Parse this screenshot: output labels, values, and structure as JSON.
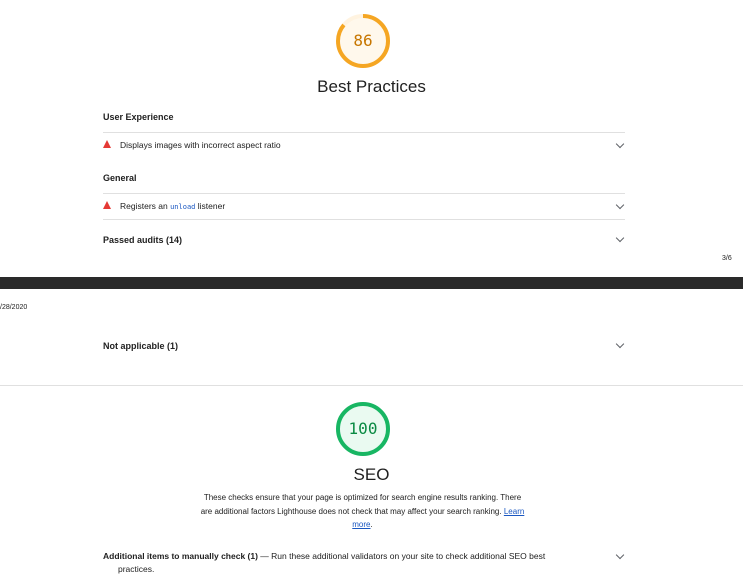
{
  "best_practices": {
    "score": "86",
    "score_fraction": 0.86,
    "score_color": "#f5a623",
    "title": "Best Practices",
    "groups": [
      {
        "title": "User Experience",
        "audit": "Displays images with incorrect aspect ratio"
      },
      {
        "title": "General",
        "audit_prefix": "Registers an",
        "audit_code": "unload",
        "audit_suffix": "listener"
      }
    ],
    "passed_audits": "Passed audits (14)"
  },
  "page_footer": {
    "page_number": "3/6"
  },
  "page_header": {
    "date": "/28/2020"
  },
  "not_applicable": "Not applicable (1)",
  "seo": {
    "score": "100",
    "score_fraction": 1.0,
    "score_color": "#18b663",
    "title": "SEO",
    "description": "These checks ensure that your page is optimized for search engine results ranking. There are additional factors Lighthouse does not check that may affect your search ranking.",
    "learn_more": "Learn more",
    "manual_title": "Additional items to manually check (1)",
    "manual_text": "— Run these additional validators on your site to check additional SEO best",
    "manual_text_2": "practices."
  },
  "colors": {
    "warning": "#e53935",
    "link": "#1a57c1",
    "divider": "#e0e0e0"
  }
}
